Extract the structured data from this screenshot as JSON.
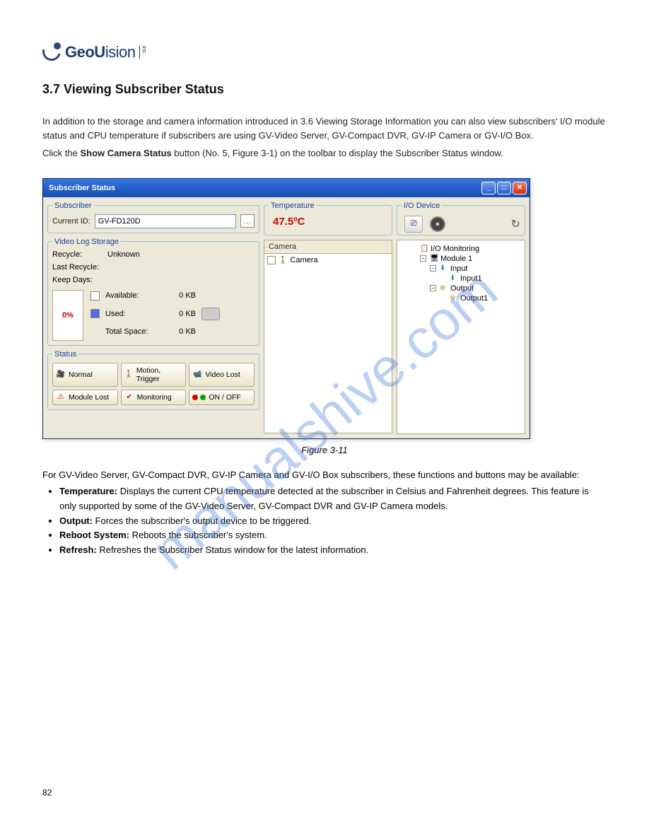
{
  "logo": {
    "text_bold": "GeoU",
    "text_lite": "ision",
    "inc": "inc."
  },
  "section_header": "3.7  Viewing Subscriber Status",
  "intro_p1": "In addition to the storage and camera information introduced in 3.6 Viewing Storage Information you can also view subscribers' I/O module status and CPU temperature if subscribers are using GV-Video Server, GV-Compact DVR, GV-IP Camera or GV-I/O Box.",
  "intro_p2_pre": "Click the ",
  "intro_p2_bold": "Show Camera Status",
  "intro_p2_post": " button (No. 5, Figure 3-1) on the toolbar to display the Subscriber Status window.",
  "dialog": {
    "title": "Subscriber Status",
    "min_tooltip": "Minimize",
    "max_tooltip": "Maximize",
    "close_tooltip": "Close"
  },
  "subscriber": {
    "legend": "Subscriber",
    "label": "Current ID:",
    "value": "GV-FD120D",
    "browse_label": "..."
  },
  "storage": {
    "legend": "Video Log Storage",
    "recycle_label": "Recycle:",
    "recycle_value": "Unknown",
    "lastrecycle_label": "Last Recycle:",
    "lastrecycle_value": "",
    "keepdays_label": "Keep Days:",
    "keepdays_value": "",
    "bar_pct": "0%",
    "available_label": "Available:",
    "available_value": "0 KB",
    "used_label": "Used:",
    "used_value": "0 KB",
    "total_label": "Total Space:",
    "total_value": "0 KB"
  },
  "status": {
    "legend": "Status",
    "normal": "Normal",
    "motion": "Motion, Trigger",
    "video_lost": "Video Lost",
    "module_lost": "Module Lost",
    "monitoring": "Monitoring",
    "onoff": "ON / OFF"
  },
  "temperature": {
    "legend": "Temperature",
    "value": "47.5ºC"
  },
  "iodevice": {
    "legend": "I/O Device"
  },
  "camera": {
    "header": "Camera",
    "item0": "Camera"
  },
  "tree": {
    "root": "I/O Monitoring",
    "module": "Module 1",
    "input_group": "Input",
    "input1": "Input1",
    "output_group": "Output",
    "output1": "Output1"
  },
  "figure_caption": "Figure 3-11",
  "after_p": "For GV-Video Server, GV-Compact DVR, GV-IP Camera and GV-I/O Box subscribers, these functions and buttons may be available:",
  "bullets": {
    "b1_bold": "Temperature:",
    "b1_rest": " Displays the current CPU temperature detected at the subscriber in Celsius and Fahrenheit degrees. This feature is only supported by some of the GV-Video Server, GV-Compact DVR and GV-IP Camera models.",
    "b2_bold": "Output:",
    "b2_rest": " Forces the subscriber's output device to be triggered.",
    "b3_bold": "Reboot System:",
    "b3_rest": " Reboots the subscriber's system.",
    "b4_bold": "Refresh:",
    "b4_rest": " Refreshes the Subscriber Status window for the latest information."
  },
  "page_number": "82",
  "watermark": "manualshive.com"
}
